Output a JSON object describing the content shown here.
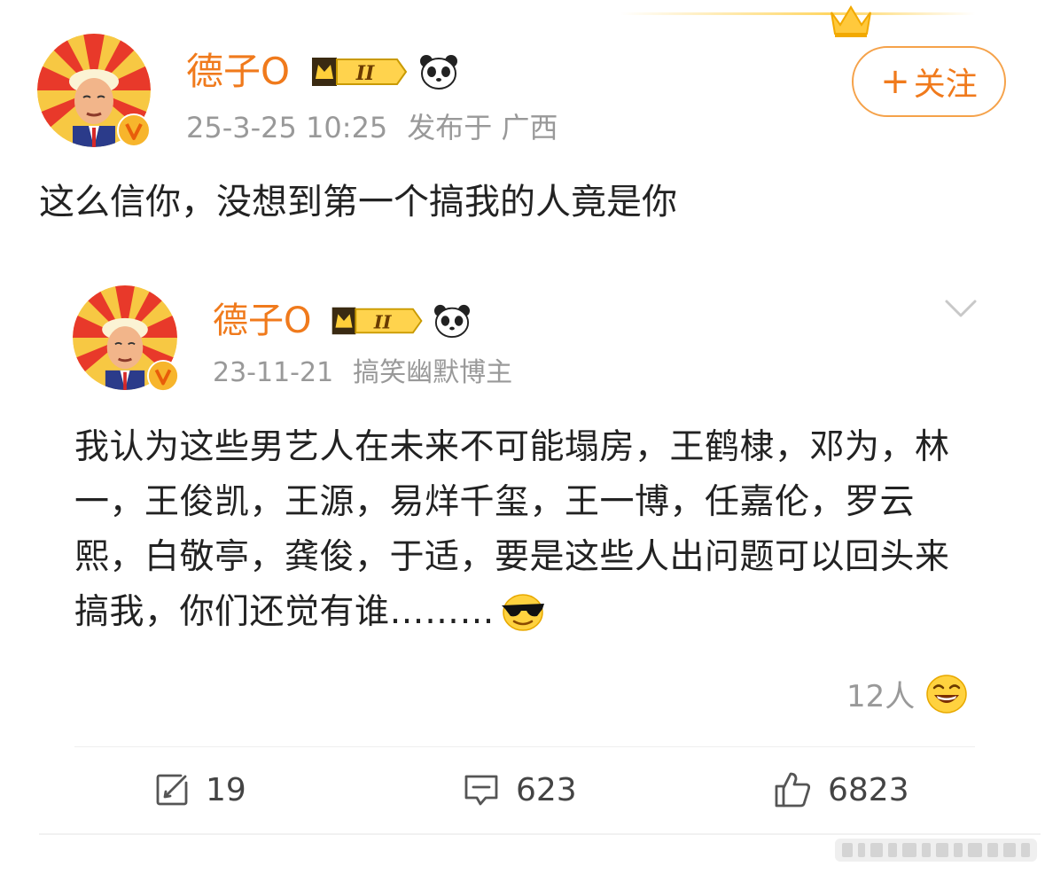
{
  "colors": {
    "username": "#f07a1c",
    "meta": "#999999",
    "follow_border": "#f5a24a",
    "text": "#222222"
  },
  "post": {
    "username": "德子O",
    "level": "II",
    "timestamp": "25-3-25 10:25",
    "location": "发布于 广西",
    "follow_label": "关注",
    "follow_plus": "+",
    "text": "这么信你，没想到第一个搞我的人竟是你"
  },
  "repost": {
    "username": "德子O",
    "level": "II",
    "date": "23-11-21",
    "tag": "搞笑幽默博主",
    "text": "我认为这些男艺人在未来不可能塌房，王鹤棣，邓为，林一，王俊凯，王源，易烊千玺，王一博，任嘉伦，罗云熙，白敬亭，龚俊，于适，要是这些人出问题可以回头来搞我，你们还觉有谁………",
    "reaction_count": "12人"
  },
  "actions": {
    "repost_count": "19",
    "comment_count": "623",
    "like_count": "6823"
  },
  "icons": [
    "crown-icon",
    "level-badge-icon",
    "panda-icon",
    "verified-icon",
    "chevron-down-icon",
    "cool-emoji-icon",
    "laugh-emoji-icon",
    "repost-icon",
    "comment-icon",
    "like-icon"
  ]
}
